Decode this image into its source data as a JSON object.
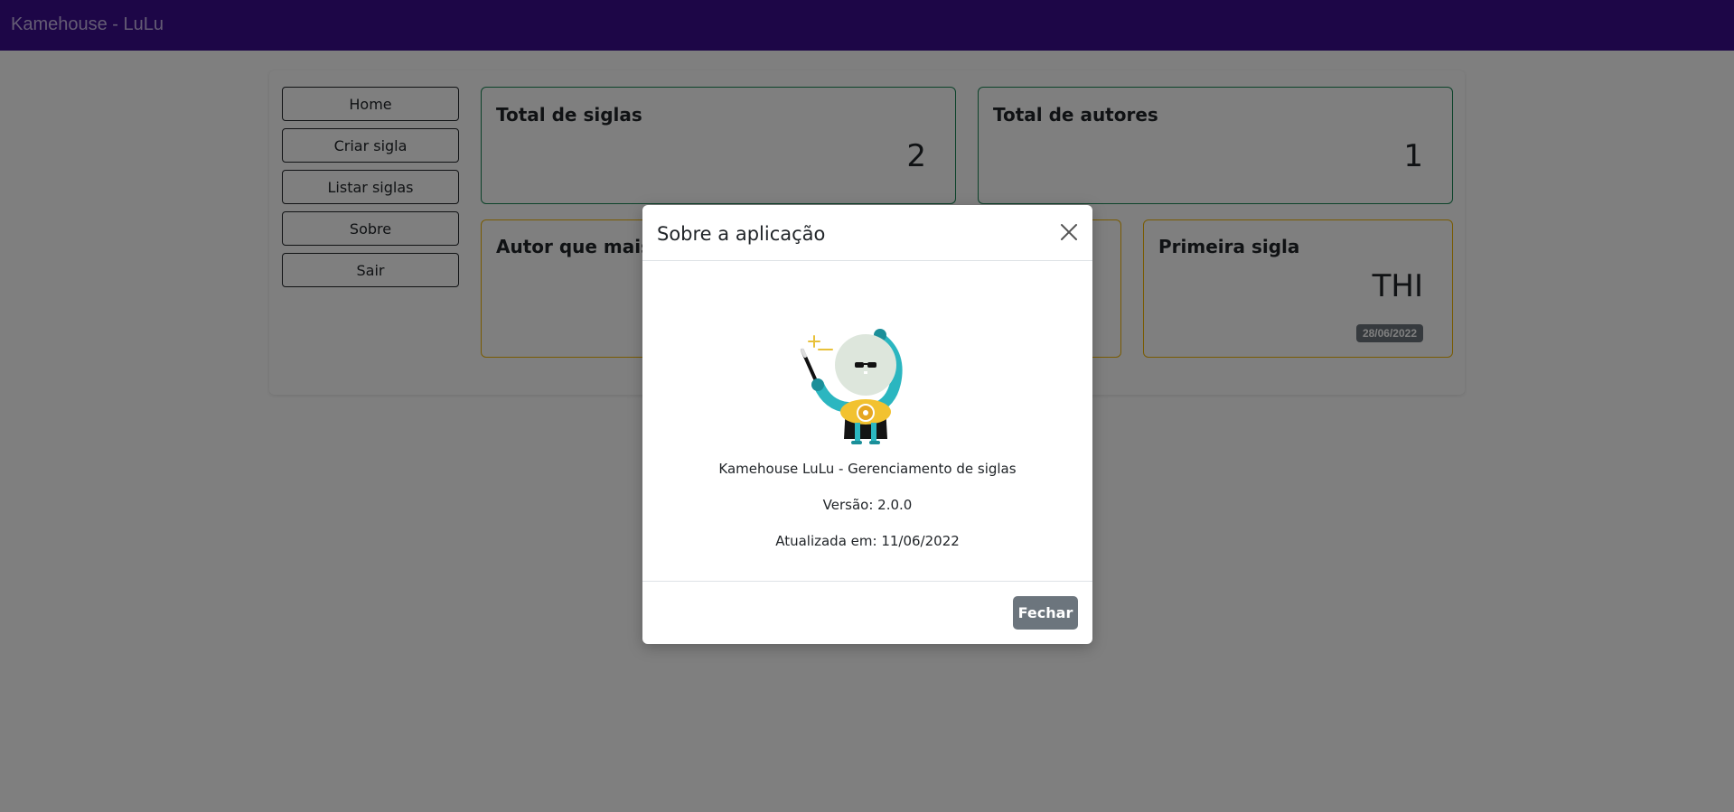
{
  "navbar": {
    "brand": "Kamehouse - LuLu"
  },
  "menu": {
    "home": "Home",
    "criar": "Criar sigla",
    "listar": "Listar siglas",
    "sobre": "Sobre",
    "sair": "Sair"
  },
  "stats": {
    "total_siglas": {
      "title": "Total de siglas",
      "value": "2"
    },
    "total_autores": {
      "title": "Total de autores",
      "value": "1"
    },
    "autor_mais": {
      "title": "Autor que mais co"
    },
    "primeira_sigla": {
      "title": "Primeira sigla",
      "value": "THI",
      "date": "28/06/2022"
    }
  },
  "modal": {
    "title": "Sobre a aplicação",
    "app_name": "Kamehouse LuLu - Gerenciamento de siglas",
    "version": "Versão: 2.0.0",
    "updated": "Atualizada em: 11/06/2022",
    "close_label": "Fechar"
  },
  "colors": {
    "navbar": "#3b0c8f",
    "success_border": "#198754",
    "warning_border": "#f2b705",
    "secondary_button": "#6c757d"
  },
  "icons": {
    "close": "close-icon",
    "mascot": "wizard-mascot-icon"
  }
}
